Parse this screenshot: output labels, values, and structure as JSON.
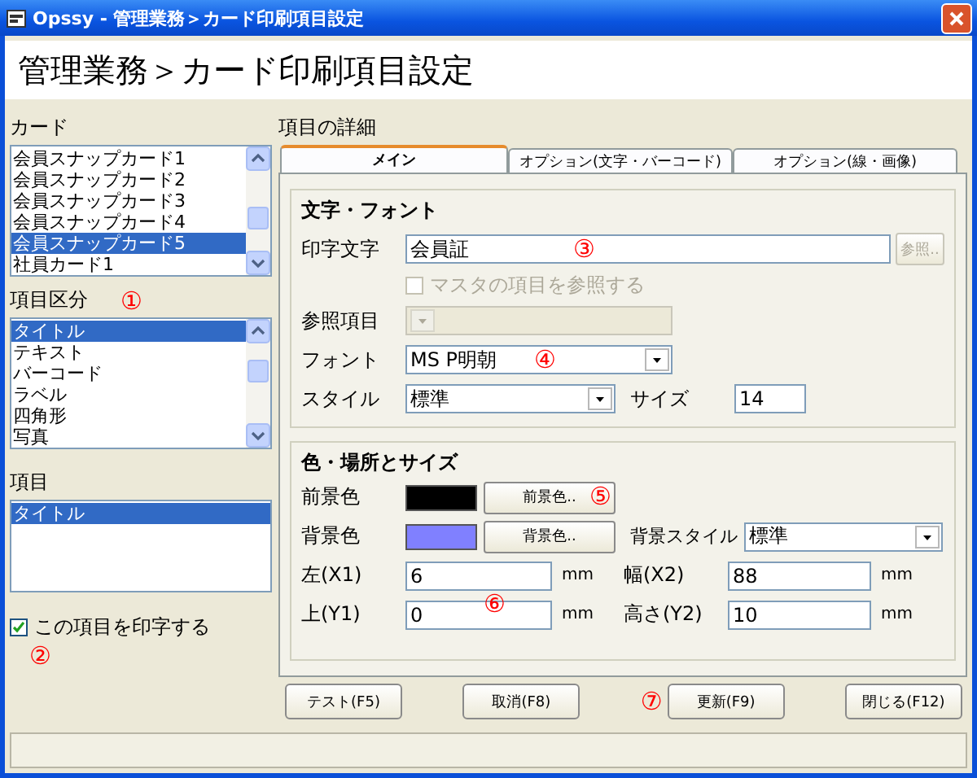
{
  "window": {
    "title": "Opssy - 管理業務＞カード印刷項目設定"
  },
  "header": {
    "title": "管理業務＞カード印刷項目設定"
  },
  "card_list": {
    "label": "カード",
    "items": [
      {
        "label": "会員スナップカード1",
        "selected": false
      },
      {
        "label": "会員スナップカード2",
        "selected": false
      },
      {
        "label": "会員スナップカード3",
        "selected": false
      },
      {
        "label": "会員スナップカード4",
        "selected": false
      },
      {
        "label": "会員スナップカード5",
        "selected": true
      },
      {
        "label": "社員カード1",
        "selected": false
      }
    ]
  },
  "category_list": {
    "label": "項目区分",
    "annotation": "①",
    "items": [
      {
        "label": "タイトル",
        "selected": true
      },
      {
        "label": "テキスト",
        "selected": false
      },
      {
        "label": "バーコード",
        "selected": false
      },
      {
        "label": "ラベル",
        "selected": false
      },
      {
        "label": "四角形",
        "selected": false
      },
      {
        "label": "写真",
        "selected": false
      }
    ]
  },
  "item_list": {
    "label": "項目",
    "items": [
      {
        "label": "タイトル",
        "selected": true
      }
    ]
  },
  "print_checkbox": {
    "label": "この項目を印字する",
    "checked": true,
    "annotation": "②"
  },
  "details": {
    "label": "項目の詳細",
    "tabs": [
      {
        "label": "メイン",
        "selected": true
      },
      {
        "label": "オプション(文字・バーコード)",
        "selected": false
      },
      {
        "label": "オプション(線・画像)",
        "selected": false
      }
    ],
    "text_font": {
      "title": "文字・フォント",
      "print_text": {
        "label": "印字文字",
        "value": "会員証",
        "annotation": "③"
      },
      "browse_button": {
        "label": "参照..",
        "disabled": true
      },
      "master_checkbox": {
        "label": "マスタの項目を参照する",
        "checked": false,
        "disabled": true
      },
      "reference_item": {
        "label": "参照項目",
        "disabled": true
      },
      "font": {
        "label": "フォント",
        "value": "MS P明朝",
        "annotation": "④"
      },
      "style": {
        "label": "スタイル",
        "value": "標準"
      },
      "size": {
        "label": "サイズ",
        "value": "14"
      }
    },
    "color_position": {
      "title": "色・場所とサイズ",
      "foreground": {
        "label": "前景色",
        "color": "#000000",
        "button": "前景色..",
        "annotation": "⑤"
      },
      "background": {
        "label": "背景色",
        "color": "#8080ff",
        "button": "背景色.."
      },
      "background_style": {
        "label": "背景スタイル",
        "value": "標準"
      },
      "annotation": "⑥",
      "fields": [
        {
          "label": "左(X1)",
          "value": "6",
          "unit": "mm"
        },
        {
          "label": "幅(X2)",
          "value": "88",
          "unit": "mm"
        },
        {
          "label": "上(Y1)",
          "value": "0",
          "unit": "mm"
        },
        {
          "label": "高さ(Y2)",
          "value": "10",
          "unit": "mm"
        }
      ]
    }
  },
  "buttons": [
    {
      "label": "テスト(F5)"
    },
    {
      "label": "取消(F8)"
    },
    {
      "label": "更新(F9)",
      "annotation": "⑦"
    },
    {
      "label": "閉じる(F12)"
    }
  ]
}
